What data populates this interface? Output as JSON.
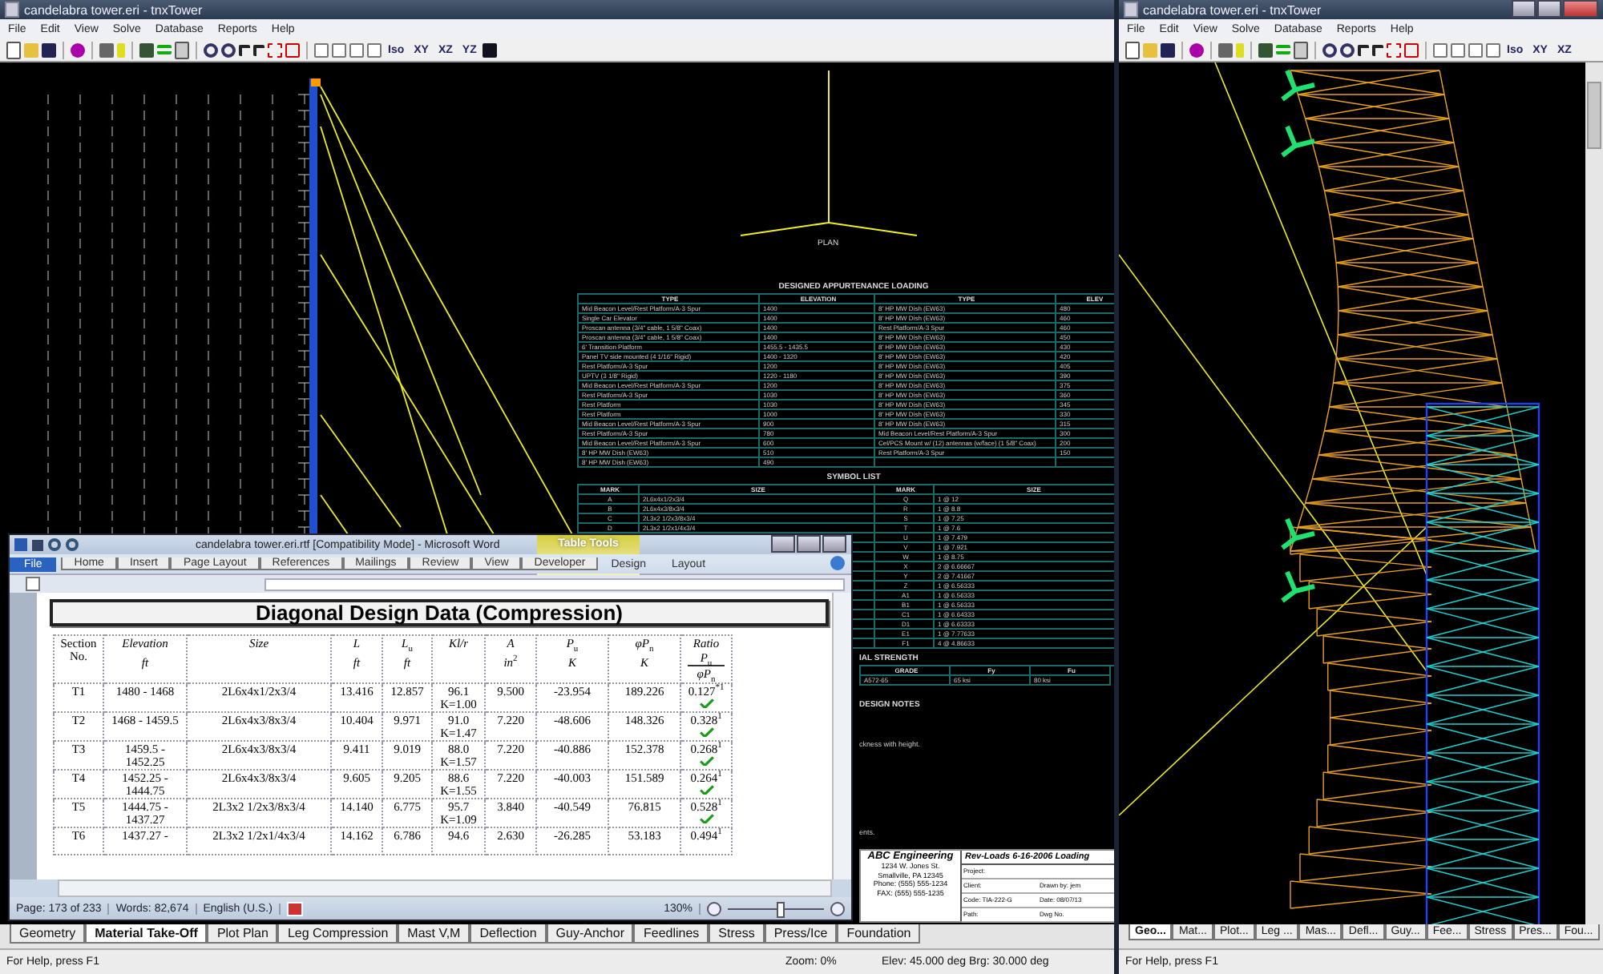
{
  "cad_window": {
    "title": "candelabra tower.eri - tnxTower",
    "menu": [
      "File",
      "Edit",
      "View",
      "Solve",
      "Database",
      "Reports",
      "Help"
    ],
    "view_buttons": [
      "Iso",
      "XY",
      "XZ",
      "YZ"
    ],
    "tabs": [
      {
        "label": "Geometry",
        "selected": false
      },
      {
        "label": "Material Take-Off",
        "selected": true
      },
      {
        "label": "Plot Plan",
        "selected": false
      },
      {
        "label": "Leg Compression",
        "selected": false
      },
      {
        "label": "Mast V,M",
        "selected": false
      },
      {
        "label": "Deflection",
        "selected": false
      },
      {
        "label": "Guy-Anchor",
        "selected": false
      },
      {
        "label": "Feedlines",
        "selected": false
      },
      {
        "label": "Stress",
        "selected": false
      },
      {
        "label": "Press/Ice",
        "selected": false
      },
      {
        "label": "Foundation",
        "selected": false
      }
    ],
    "status": {
      "help": "For Help, press F1",
      "zoom": "Zoom: 0%",
      "angles": "Elev: 45.000 deg  Brg: 30.000 deg"
    }
  },
  "drawing": {
    "plan_label": "PLAN",
    "appurtenance": {
      "title": "DESIGNED APPURTENANCE LOADING",
      "columns": [
        "TYPE",
        "ELEVATION",
        "TYPE",
        "ELEV"
      ],
      "left_rows": [
        [
          "Mid Beacon Level/Rest Platform/A-3 Spur",
          "1400"
        ],
        [
          "Single Car Elevator",
          "1400"
        ],
        [
          "Proscan antenna (3/4\" cable, 1 5/8\" Coax)",
          "1400"
        ],
        [
          "Proscan antenna (3/4\" cable, 1 5/8\" Coax)",
          "1400"
        ],
        [
          "6' Transition Platform",
          "1455.5 - 1435.5"
        ],
        [
          "Panel TV side mounted (4 1/16\" Rigid)",
          "1400 - 1320"
        ],
        [
          "Rest Platform/A-3 Spur",
          "1200"
        ],
        [
          "UPTV (3 1/8\" Rigid)",
          "1220 - 1180"
        ],
        [
          "Mid Beacon Level/Rest Platform/A-3 Spur",
          "1200"
        ],
        [
          "Rest Platform/A-3 Spur",
          "1030"
        ],
        [
          "Rest Platform",
          "1030"
        ],
        [
          "Rest Platform",
          "1000"
        ],
        [
          "Mid Beacon Level/Rest Platform/A-3 Spur",
          "900"
        ],
        [
          "Rest Platform/A-3 Spur",
          "780"
        ],
        [
          "Mid Beacon Level/Rest Platform/A-3 Spur",
          "600"
        ],
        [
          "8' HP MW Dish (EW63)",
          "510"
        ],
        [
          "8' HP MW Dish (EW63)",
          "490"
        ]
      ],
      "right_rows": [
        [
          "8' HP MW Dish (EW63)",
          "480"
        ],
        [
          "8' HP MW Dish (EW63)",
          "460"
        ],
        [
          "Rest Platform/A-3 Spur",
          "460"
        ],
        [
          "8' HP MW Dish (EW63)",
          "450"
        ],
        [
          "8' HP MW Dish (EW63)",
          "430"
        ],
        [
          "8' HP MW Dish (EW63)",
          "420"
        ],
        [
          "8' HP MW Dish (EW63)",
          "405"
        ],
        [
          "8' HP MW Dish (EW63)",
          "390"
        ],
        [
          "8' HP MW Dish (EW63)",
          "375"
        ],
        [
          "8' HP MW Dish (EW63)",
          "360"
        ],
        [
          "8' HP MW Dish (EW63)",
          "345"
        ],
        [
          "8' HP MW Dish (EW63)",
          "330"
        ],
        [
          "8' HP MW Dish (EW63)",
          "315"
        ],
        [
          "Mid Beacon Level/Rest Platform/A-3 Spur",
          "300"
        ],
        [
          "Cel/PCS Mount w/ (12) antennas (w/face) (1 5/8\" Coax)",
          "200"
        ],
        [
          "Rest Platform/A-3 Spur",
          "150"
        ]
      ]
    },
    "symbols": {
      "title": "SYMBOL LIST",
      "columns": [
        "MARK",
        "SIZE",
        "MARK",
        "SIZE"
      ],
      "left_rows": [
        [
          "A",
          "2L6x4x1/2x3/4"
        ],
        [
          "B",
          "2L6x4x3/8x3/4"
        ],
        [
          "C",
          "2L3x2 1/2x3/8x3/4"
        ],
        [
          "D",
          "2L3x2 1/2x1/4x3/4"
        ]
      ],
      "right_rows": [
        [
          "Q",
          "1 @ 12"
        ],
        [
          "R",
          "1 @ 8.8"
        ],
        [
          "S",
          "1 @ 7.25"
        ],
        [
          "T",
          "1 @ 7.6"
        ],
        [
          "U",
          "1 @ 7.479"
        ],
        [
          "V",
          "1 @ 7.921"
        ],
        [
          "W",
          "1 @ 8.75"
        ],
        [
          "X",
          "2 @ 6.66667"
        ],
        [
          "Y",
          "2 @ 7.41667"
        ],
        [
          "Z",
          "1 @ 6.56333"
        ],
        [
          "A1",
          "1 @ 6.56333"
        ],
        [
          "B1",
          "1 @ 6.56333"
        ],
        [
          "C1",
          "1 @ 6.64333"
        ],
        [
          "D1",
          "1 @ 6.63333"
        ],
        [
          "E1",
          "1 @ 7.77633"
        ],
        [
          "F1",
          "4 @ 4.86633"
        ]
      ]
    },
    "strength": {
      "title": "IAL STRENGTH",
      "columns": [
        "GRADE",
        "Fy",
        "Fu"
      ],
      "row": [
        "A572-65",
        "65 ksi",
        "80 ksi"
      ]
    },
    "notes": {
      "title": "DESIGN NOTES",
      "lines": [
        "ckness with height.",
        "ents."
      ]
    },
    "title_block": {
      "company": "ABC Engineering",
      "address": [
        "1234 W. Jones St.",
        "Smallville, PA 12345",
        "Phone: (555) 555-1234",
        "FAX: (555) 555-1235"
      ],
      "job": "Rev-Loads 6-16-2006 Loading",
      "fields": [
        [
          "Project:"
        ],
        [
          "Client:",
          "Drawn by: jem"
        ],
        [
          "Code: TIA-222-G",
          "Date: 08/07/13"
        ],
        [
          "Path:",
          "Dwg No."
        ]
      ]
    }
  },
  "word_window": {
    "title": "candelabra tower.eri.rtf [Compatibility Mode] - Microsoft Word",
    "context_tab": "Table Tools",
    "tabs": [
      {
        "label": "File",
        "kind": "file",
        "selected": false
      },
      {
        "label": "Home",
        "kind": "tab",
        "selected": false
      },
      {
        "label": "Insert",
        "kind": "tab",
        "selected": false
      },
      {
        "label": "Page Layout",
        "kind": "tab",
        "selected": false
      },
      {
        "label": "References",
        "kind": "tab",
        "selected": false
      },
      {
        "label": "Mailings",
        "kind": "tab",
        "selected": false
      },
      {
        "label": "Review",
        "kind": "tab",
        "selected": false
      },
      {
        "label": "View",
        "kind": "tab",
        "selected": false
      },
      {
        "label": "Developer",
        "kind": "tab",
        "selected": false
      },
      {
        "label": "Design",
        "kind": "context",
        "selected": false
      },
      {
        "label": "Layout",
        "kind": "context",
        "selected": false
      }
    ],
    "heading": "Diagonal Design Data (Compression)",
    "columns": [
      {
        "label": "Section No."
      },
      {
        "label": "*Elevation*",
        "unit": "*ft*"
      },
      {
        "label": "*Size*"
      },
      {
        "label": "*L*",
        "unit": "*ft*"
      },
      {
        "label": "*L*$_{u}$",
        "unit": "*ft*"
      },
      {
        "label": "*Kl/r*"
      },
      {
        "label": "*A*",
        "unit": "*in*$^{2}$"
      },
      {
        "label": "*P*$_{u}$",
        "unit": "*K*"
      },
      {
        "label": "*φP*$_{n}$",
        "unit": "*K*"
      },
      {
        "label": "*Ratio*",
        "kind": "fraction",
        "top": "*P*$_{u}$",
        "bottom": "*φP*$_{n}$"
      }
    ],
    "rows": [
      {
        "cells": [
          "T1",
          "1480 - 1468",
          "2L6x4x1/2x3/4",
          "13.416",
          "12.857",
          "96.1 K=1.00",
          "9.500",
          "-23.954",
          "189.226"
        ],
        "ratio": "0.127$^{*1}$",
        "ok": true
      },
      {
        "cells": [
          "T2",
          "1468 - 1459.5",
          "2L6x4x3/8x3/4",
          "10.404",
          "9.971",
          "91.0 K=1.47",
          "7.220",
          "-48.606",
          "148.326"
        ],
        "ratio": "0.328$^{1}$",
        "ok": true
      },
      {
        "cells": [
          "T3",
          "1459.5 - 1452.25",
          "2L6x4x3/8x3/4",
          "9.411",
          "9.019",
          "88.0 K=1.57",
          "7.220",
          "-40.886",
          "152.378"
        ],
        "ratio": "0.268$^{1}$",
        "ok": true
      },
      {
        "cells": [
          "T4",
          "1452.25 - 1444.75",
          "2L6x4x3/8x3/4",
          "9.605",
          "9.205",
          "88.6 K=1.55",
          "7.220",
          "-40.003",
          "151.589"
        ],
        "ratio": "0.264$^{1}$",
        "ok": true
      },
      {
        "cells": [
          "T5",
          "1444.75 - 1437.27",
          "2L3x2 1/2x3/8x3/4",
          "14.140",
          "6.775",
          "95.7 K=1.09",
          "3.840",
          "-40.549",
          "76.815"
        ],
        "ratio": "0.528$^{1}$",
        "ok": true
      },
      {
        "cells": [
          "T6",
          "1437.27 -",
          "2L3x2 1/2x1/4x3/4",
          "14.162",
          "6.786",
          "94.6",
          "2.630",
          "-26.285",
          "53.183"
        ],
        "ratio": "0.494$^{1}$",
        "ok": false
      }
    ],
    "status": [
      "Page: 173 of 233",
      "Words: 82,674",
      "English (U.S.)"
    ],
    "zoom": "130%",
    "zoom_slider": {
      "level": 0.55
    }
  },
  "tower_window": {
    "title": "candelabra tower.eri - tnxTower",
    "menu": [
      "File",
      "Edit",
      "View",
      "Solve",
      "Database",
      "Reports",
      "Help"
    ],
    "view_buttons": [
      "Iso",
      "XY",
      "XZ"
    ],
    "tabs": [
      {
        "label": "Geo...",
        "selected": true
      },
      {
        "label": "Mat...",
        "selected": false
      },
      {
        "label": "Plot...",
        "selected": false
      },
      {
        "label": "Leg ...",
        "selected": false
      },
      {
        "label": "Mas...",
        "selected": false
      },
      {
        "label": "Defl...",
        "selected": false
      },
      {
        "label": "Guy...",
        "selected": false
      },
      {
        "label": "Fee...",
        "selected": false
      },
      {
        "label": "Stress",
        "selected": false
      },
      {
        "label": "Pres...",
        "selected": false
      },
      {
        "label": "Fou...",
        "selected": false
      }
    ],
    "status": "For Help, press F1"
  }
}
